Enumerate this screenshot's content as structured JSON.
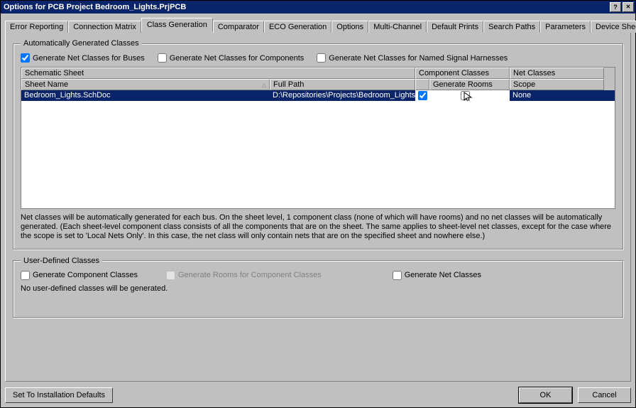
{
  "window": {
    "title": "Options for PCB Project Bedroom_Lights.PrjPCB"
  },
  "tabs": {
    "items": [
      {
        "label": "Error Reporting"
      },
      {
        "label": "Connection Matrix"
      },
      {
        "label": "Class Generation",
        "active": true
      },
      {
        "label": "Comparator"
      },
      {
        "label": "ECO Generation"
      },
      {
        "label": "Options"
      },
      {
        "label": "Multi-Channel"
      },
      {
        "label": "Default Prints"
      },
      {
        "label": "Search Paths"
      },
      {
        "label": "Parameters"
      },
      {
        "label": "Device Sheets"
      }
    ]
  },
  "auto": {
    "legend": "Automatically Generated Classes",
    "cb_buses": "Generate Net Classes for Buses",
    "cb_components": "Generate Net Classes for Components",
    "cb_harnesses": "Generate Net Classes for Named Signal Harnesses",
    "cb_buses_checked": true,
    "cb_components_checked": false,
    "cb_harnesses_checked": false,
    "grid": {
      "group_headers": {
        "schematic": "Schematic Sheet",
        "compcls": "Component Classes",
        "netcls": "Net Classes"
      },
      "col_headers": {
        "sheet": "Sheet Name",
        "path": "Full Path",
        "cc": "",
        "room": "Generate Rooms",
        "scope": "Scope"
      },
      "rows": [
        {
          "sheet": "Bedroom_Lights.SchDoc",
          "path": "D:\\Repositories\\Projects\\Bedroom_Lights\\Bed",
          "cc_checked": true,
          "room_checked": false,
          "scope": "None"
        }
      ]
    },
    "note": "Net classes will be automatically generated for each bus. On the sheet level, 1 component class (none of which will have rooms) and no net classes will be automatically generated. (Each sheet-level component class consists of all the components that are on the sheet. The same applies to sheet-level net classes, except for the case where the scope is set to 'Local Nets Only'. In this case, the net class will only contain nets that are on the specified sheet and nowhere else.)"
  },
  "user": {
    "legend": "User-Defined Classes",
    "cb_comp": "Generate Component Classes",
    "cb_rooms": "Generate Rooms for Component Classes",
    "cb_net": "Generate Net Classes",
    "cb_comp_checked": false,
    "cb_rooms_checked": false,
    "cb_net_checked": false,
    "note": "No user-defined classes will be generated."
  },
  "footer": {
    "defaults": "Set To Installation Defaults",
    "ok": "OK",
    "cancel": "Cancel"
  }
}
